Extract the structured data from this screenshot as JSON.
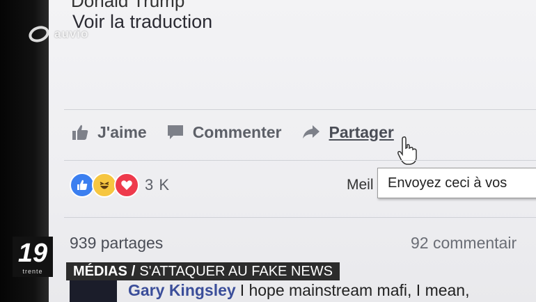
{
  "post": {
    "author_cut": "Donald Trump",
    "translate_link": "Voir la traduction"
  },
  "actions": {
    "like": "J'aime",
    "comment": "Commenter",
    "share": "Partager"
  },
  "reactions": {
    "count": "3 K",
    "icons": [
      "like-icon",
      "haha-icon",
      "love-icon"
    ]
  },
  "more_text": "Meil",
  "tooltip": "Envoyez ceci à vos",
  "stats": {
    "shares": "939 partages",
    "comments": "92 commentair"
  },
  "comment": {
    "author": "Gary Kingsley",
    "text": "I hope mainstream mafi, I mean,"
  },
  "overlay": {
    "logo": "auvio",
    "channel_number": "19",
    "channel_sub": "trente",
    "banner_category": "MÉDIAS",
    "banner_separator": "/",
    "banner_title": "S'ATTAQUER AU FAKE NEWS"
  },
  "colors": {
    "reaction_like": "#3b7ff0",
    "reaction_haha": "#f6c640",
    "reaction_love": "#ee3a4c",
    "comment_author": "#3b4e9a"
  }
}
